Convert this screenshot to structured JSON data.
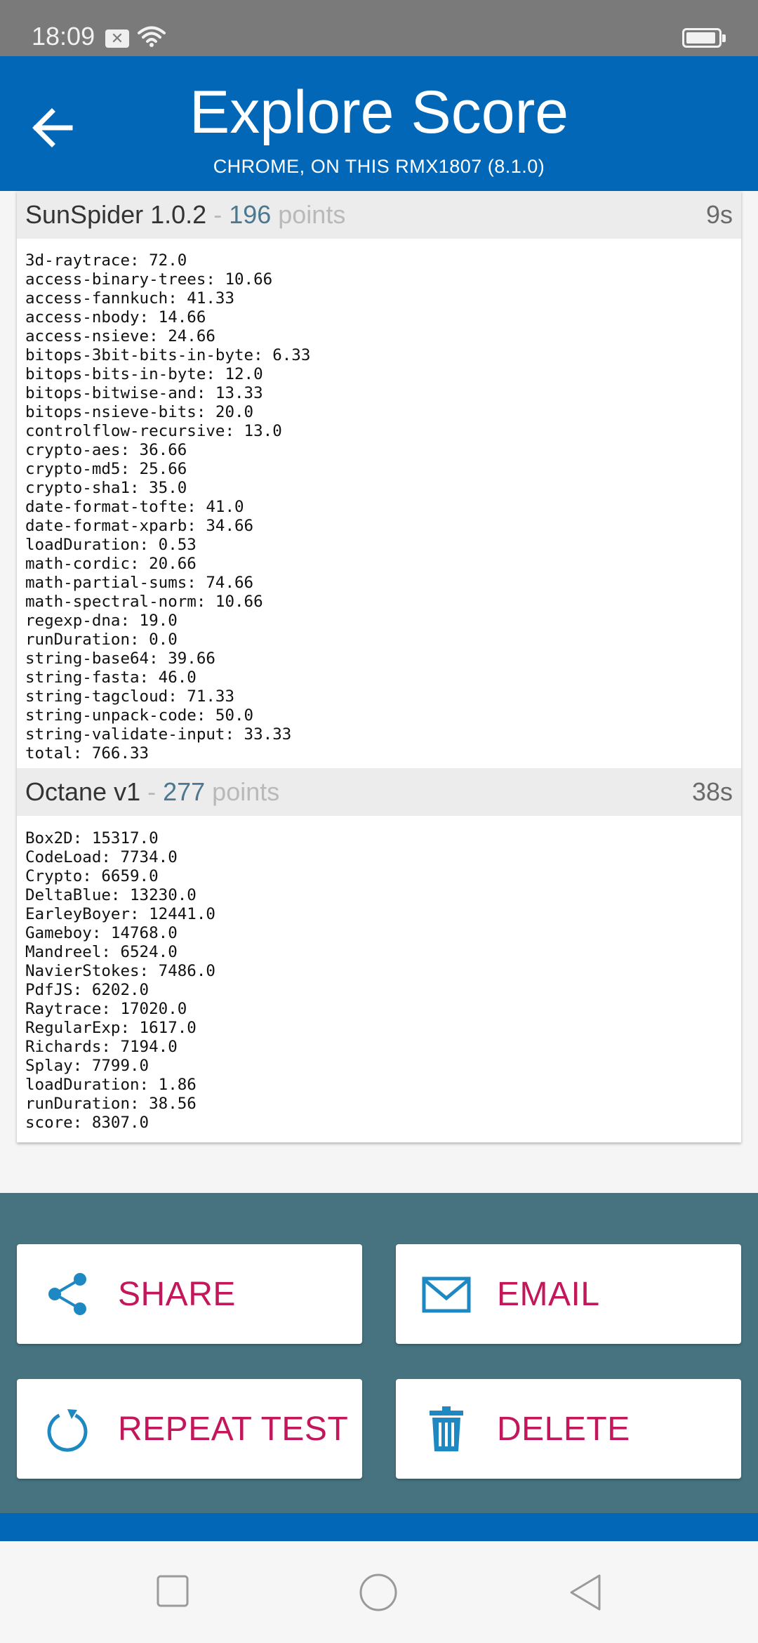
{
  "status_bar": {
    "time": "18:09",
    "notification_glyph": "✕"
  },
  "header": {
    "title": "Explore Score",
    "subtitle": "CHROME, ON THIS RMX1807 (8.1.0)"
  },
  "benchmarks": [
    {
      "name": "SunSpider 1.0.2",
      "separator": "-",
      "points": "196",
      "points_label": "points",
      "duration": "9s",
      "results": [
        "3d-raytrace: 72.0",
        "access-binary-trees: 10.66",
        "access-fannkuch: 41.33",
        "access-nbody: 14.66",
        "access-nsieve: 24.66",
        "bitops-3bit-bits-in-byte: 6.33",
        "bitops-bits-in-byte: 12.0",
        "bitops-bitwise-and: 13.33",
        "bitops-nsieve-bits: 20.0",
        "controlflow-recursive: 13.0",
        "crypto-aes: 36.66",
        "crypto-md5: 25.66",
        "crypto-sha1: 35.0",
        "date-format-tofte: 41.0",
        "date-format-xparb: 34.66",
        "loadDuration: 0.53",
        "math-cordic: 20.66",
        "math-partial-sums: 74.66",
        "math-spectral-norm: 10.66",
        "regexp-dna: 19.0",
        "runDuration: 0.0",
        "string-base64: 39.66",
        "string-fasta: 46.0",
        "string-tagcloud: 71.33",
        "string-unpack-code: 50.0",
        "string-validate-input: 33.33",
        "total: 766.33"
      ]
    },
    {
      "name": "Octane v1",
      "separator": "-",
      "points": "277",
      "points_label": "points",
      "duration": "38s",
      "results": [
        "Box2D: 15317.0",
        "CodeLoad: 7734.0",
        "Crypto: 6659.0",
        "DeltaBlue: 13230.0",
        "EarleyBoyer: 12441.0",
        "Gameboy: 14768.0",
        "Mandreel: 6524.0",
        "NavierStokes: 7486.0",
        "PdfJS: 6202.0",
        "Raytrace: 17020.0",
        "RegularExp: 1617.0",
        "Richards: 7194.0",
        "Splay: 7799.0",
        "loadDuration: 1.86",
        "runDuration: 38.56",
        "score: 8307.0"
      ]
    }
  ],
  "actions": {
    "share": "SHARE",
    "email": "EMAIL",
    "repeat": "REPEAT TEST",
    "delete": "DELETE"
  },
  "colors": {
    "header_blue": "#0367b7",
    "action_panel": "#47727f",
    "action_label": "#c2185b",
    "icon_blue": "#1e88c2",
    "points_value": "#4a7890"
  },
  "icons": {
    "back": "arrow-left-icon",
    "share": "share-icon",
    "email": "envelope-icon",
    "repeat": "refresh-icon",
    "delete": "trash-icon",
    "nav_recents": "square-icon",
    "nav_home": "circle-icon",
    "nav_back": "triangle-icon"
  }
}
